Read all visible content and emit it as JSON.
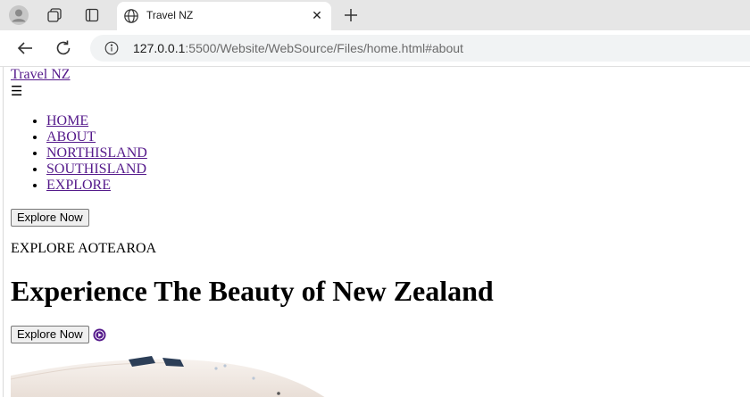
{
  "browser": {
    "tab": {
      "title": "Travel NZ"
    },
    "address": {
      "host": "127.0.0.1",
      "rest": ":5500/Website/WebSource/Files/home.html#about"
    }
  },
  "page": {
    "brand": "Travel NZ",
    "menu_toggle": "☰",
    "nav": [
      "HOME",
      "ABOUT",
      "NORTHISLAND",
      "SOUTHISLAND",
      "EXPLORE"
    ],
    "explore_button_top": "Explore Now",
    "eyebrow": "EXPLORE AOTEAROA",
    "headline": "Experience The Beauty of New Zealand",
    "explore_button_hero": "Explore Now"
  },
  "colors": {
    "visited_link": "#551a8b",
    "tab_strip": "#e6e6e6",
    "omnibox": "#f1f3f4"
  }
}
